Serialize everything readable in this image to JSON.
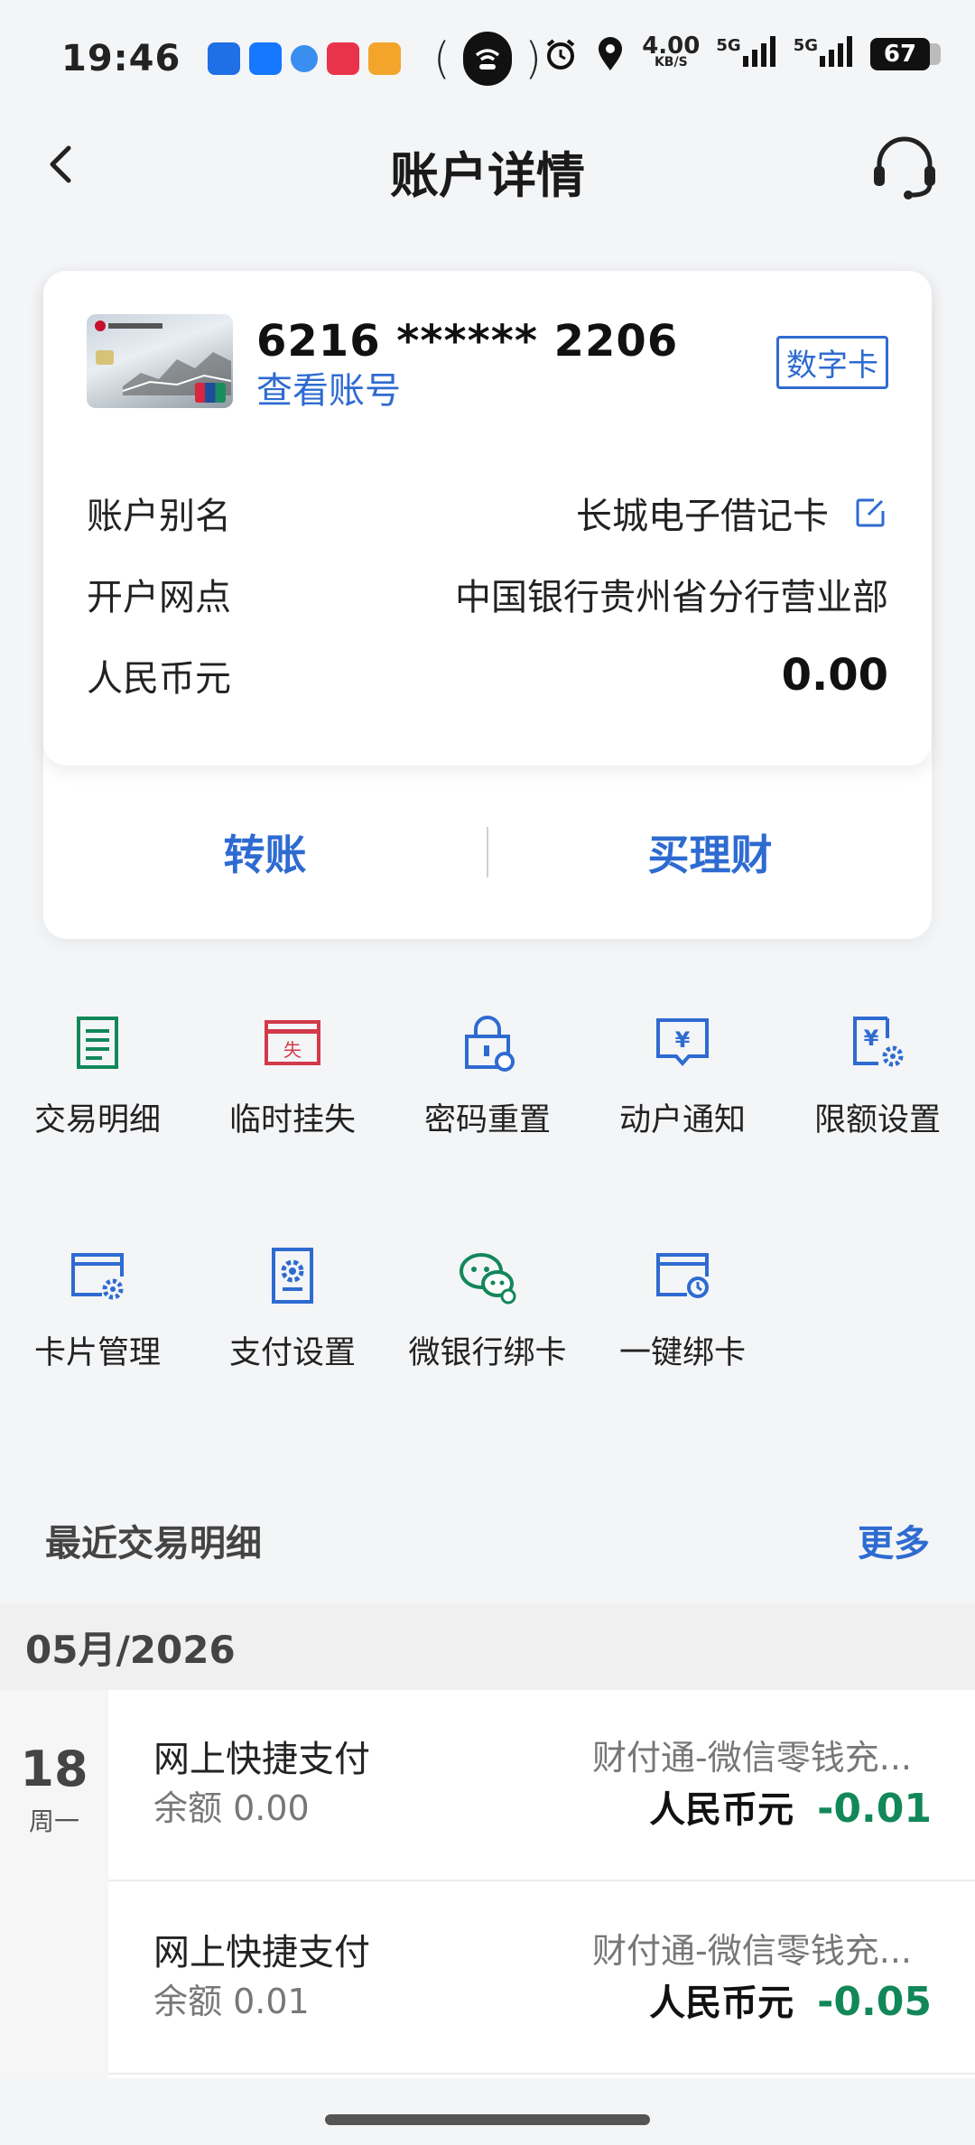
{
  "status_bar": {
    "time": "19:46",
    "net_speed_value": "4.00",
    "net_speed_unit": "KB/S",
    "signal1": "5G",
    "signal2": "5G",
    "battery": "67"
  },
  "header": {
    "title": "账户详情"
  },
  "account": {
    "card_number": "6216 ****** 2206",
    "view_account": "查看账号",
    "badge": "数字卡",
    "rows": [
      {
        "label": "账户别名",
        "value": "长城电子借记卡"
      },
      {
        "label": "开户网点",
        "value": "中国银行贵州省分行营业部"
      },
      {
        "label": "人民币元",
        "value": "0.00"
      }
    ],
    "actions": {
      "transfer": "转账",
      "buy_wealth": "买理财"
    }
  },
  "services": {
    "row1": [
      {
        "label": "交易明细",
        "icon": "list-icon",
        "color": "#12875a"
      },
      {
        "label": "临时挂失",
        "icon": "report-loss-icon",
        "color": "#d23a4a"
      },
      {
        "label": "密码重置",
        "icon": "lock-reset-icon",
        "color": "#2e6bd1"
      },
      {
        "label": "动户通知",
        "icon": "yuan-message-icon",
        "color": "#2e6bd1"
      },
      {
        "label": "限额设置",
        "icon": "yuan-gear-icon",
        "color": "#2e6bd1"
      }
    ],
    "row2": [
      {
        "label": "卡片管理",
        "icon": "card-gear-icon",
        "color": "#2e6bd1"
      },
      {
        "label": "支付设置",
        "icon": "payment-settings-icon",
        "color": "#2e6bd1"
      },
      {
        "label": "微银行绑卡",
        "icon": "wechat-icon",
        "color": "#12875a"
      },
      {
        "label": "一键绑卡",
        "icon": "card-bind-icon",
        "color": "#2e6bd1"
      }
    ]
  },
  "recent": {
    "title": "最近交易明细",
    "more": "更多",
    "month": "05月/2026",
    "day": "18",
    "weekday": "周一",
    "transactions": [
      {
        "name": "网上快捷支付",
        "balance": "余额 0.00",
        "merchant": "财付通-微信零钱充...",
        "currency": "人民币元",
        "amount": "-0.01"
      },
      {
        "name": "网上快捷支付",
        "balance": "余额 0.01",
        "merchant": "财付通-微信零钱充...",
        "currency": "人民币元",
        "amount": "-0.05"
      }
    ]
  },
  "colors": {
    "accent_blue": "#2e6bd1",
    "accent_green": "#12875a",
    "accent_red": "#d23a4a"
  }
}
